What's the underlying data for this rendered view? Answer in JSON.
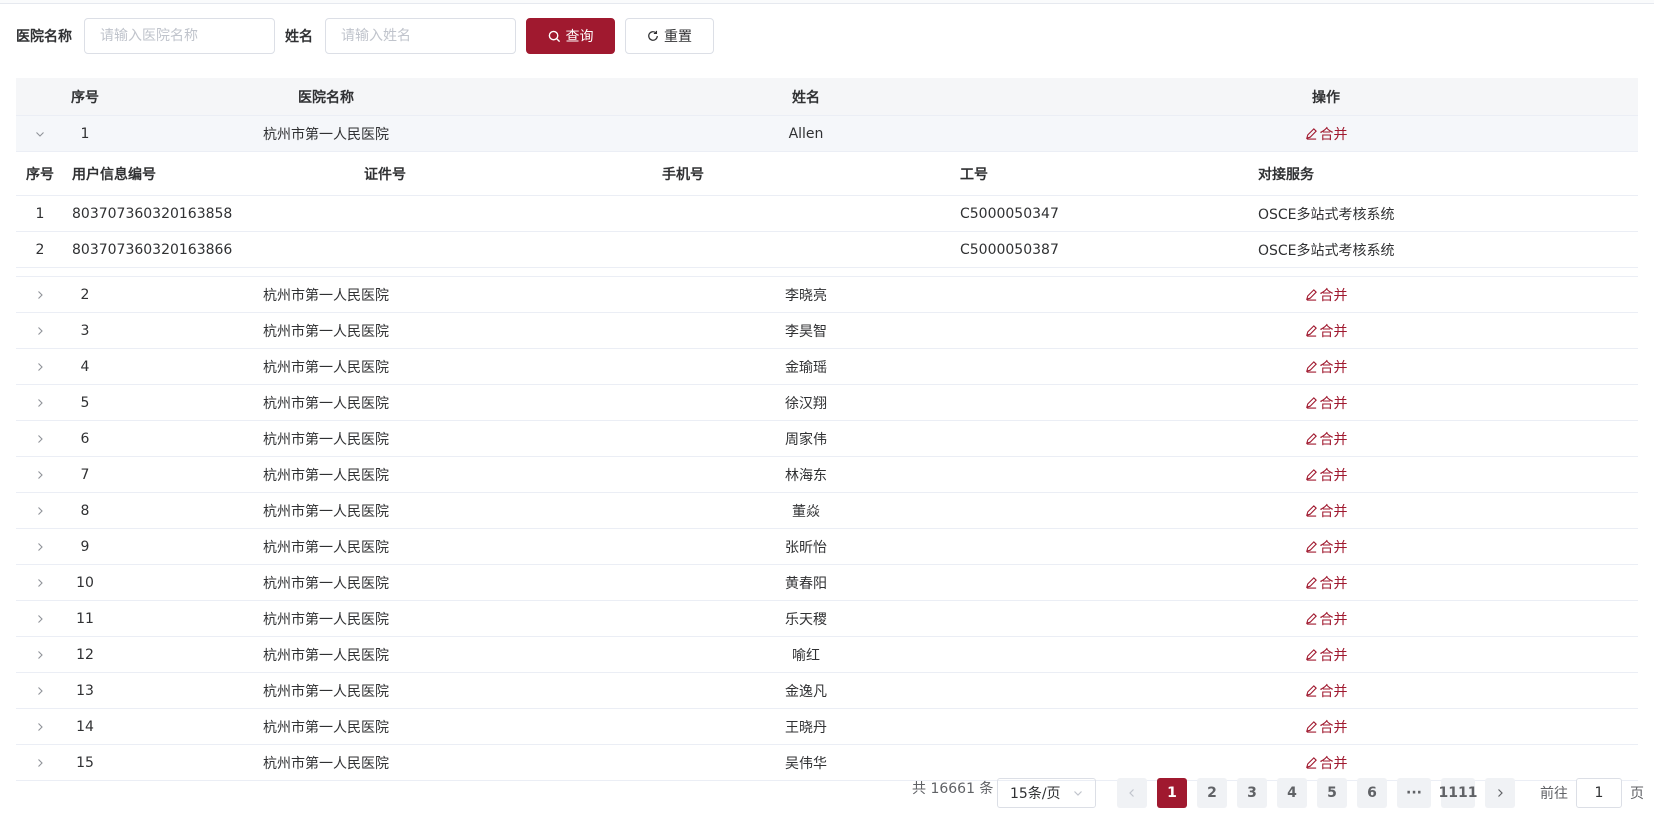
{
  "search": {
    "hospital_label": "医院名称",
    "hospital_placeholder": "请输入医院名称",
    "name_label": "姓名",
    "name_placeholder": "请输入姓名",
    "query_label": "查询",
    "reset_label": "重置"
  },
  "table": {
    "headers": {
      "index": "序号",
      "hospital": "医院名称",
      "name": "姓名",
      "action": "操作"
    },
    "merge_label": "合并",
    "rows": [
      {
        "index": "1",
        "hospital": "杭州市第一人民医院",
        "name": "Allen"
      },
      {
        "index": "2",
        "hospital": "杭州市第一人民医院",
        "name": "李晓亮"
      },
      {
        "index": "3",
        "hospital": "杭州市第一人民医院",
        "name": "李昊智"
      },
      {
        "index": "4",
        "hospital": "杭州市第一人民医院",
        "name": "金瑜瑶"
      },
      {
        "index": "5",
        "hospital": "杭州市第一人民医院",
        "name": "徐汉翔"
      },
      {
        "index": "6",
        "hospital": "杭州市第一人民医院",
        "name": "周家伟"
      },
      {
        "index": "7",
        "hospital": "杭州市第一人民医院",
        "name": "林海东"
      },
      {
        "index": "8",
        "hospital": "杭州市第一人民医院",
        "name": "董焱"
      },
      {
        "index": "9",
        "hospital": "杭州市第一人民医院",
        "name": "张昕怡"
      },
      {
        "index": "10",
        "hospital": "杭州市第一人民医院",
        "name": "黄春阳"
      },
      {
        "index": "11",
        "hospital": "杭州市第一人民医院",
        "name": "乐天稷"
      },
      {
        "index": "12",
        "hospital": "杭州市第一人民医院",
        "name": "喻红"
      },
      {
        "index": "13",
        "hospital": "杭州市第一人民医院",
        "name": "金逸凡"
      },
      {
        "index": "14",
        "hospital": "杭州市第一人民医院",
        "name": "王晓丹"
      },
      {
        "index": "15",
        "hospital": "杭州市第一人民医院",
        "name": "吴伟华"
      }
    ]
  },
  "subtable": {
    "headers": {
      "index": "序号",
      "user_id": "用户信息编号",
      "cert": "证件号",
      "phone": "手机号",
      "work_id": "工号",
      "service": "对接服务"
    },
    "rows": [
      {
        "index": "1",
        "user_id": "803707360320163858",
        "cert": "",
        "phone": "",
        "work_id": "C5000050347",
        "service": "OSCE多站式考核系统"
      },
      {
        "index": "2",
        "user_id": "803707360320163866",
        "cert": "",
        "phone": "",
        "work_id": "C5000050387",
        "service": "OSCE多站式考核系统"
      }
    ]
  },
  "pagination": {
    "total_text": "共 16661 条",
    "page_size": "15条/页",
    "pages": [
      "1",
      "2",
      "3",
      "4",
      "5",
      "6"
    ],
    "ellipsis": "···",
    "last_page": "1111",
    "current": "1",
    "goto_label": "前往",
    "goto_value": "1",
    "page_suffix": "页"
  },
  "colors": {
    "brand": "#a0192f"
  }
}
